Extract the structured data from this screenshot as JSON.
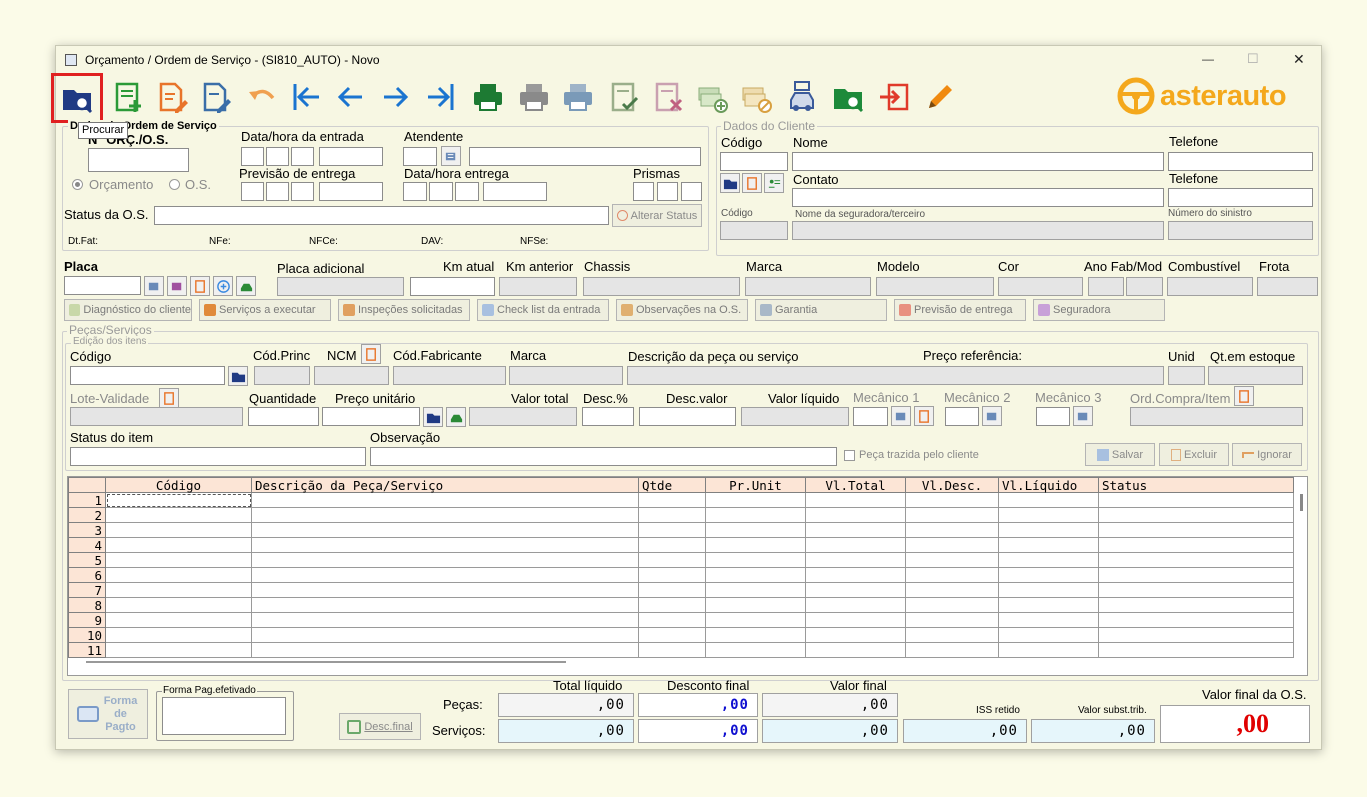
{
  "window": {
    "title": "Orçamento / Ordem de Serviço - (SI810_AUTO) - Novo",
    "minimize": "—",
    "maximize": "☐",
    "close": "✕"
  },
  "toolbar": {
    "tooltip": "Procurar"
  },
  "brand": {
    "name": "asterauto",
    "accent": "#f4a81c"
  },
  "header": {
    "group_title": "Dados da Ordem de Serviço",
    "num_label": "N° ORÇ./O.S.",
    "entrada_label": "Data/hora da entrada",
    "atendente_label": "Atendente",
    "previsao_label": "Previsão de entrega",
    "entrega_label": "Data/hora entrega",
    "prismas_label": "Prismas",
    "radio_orcamento": "Orçamento",
    "radio_os": "O.S.",
    "status_label": "Status da O.S.",
    "alterar_status": "Alterar Status",
    "dtfat": "Dt.Fat:",
    "nfe": "NFe:",
    "nfce": "NFCe:",
    "dav": "DAV:",
    "nfse": "NFSe:"
  },
  "cliente": {
    "group_title": "Dados do Cliente",
    "codigo": "Código",
    "nome": "Nome",
    "telefone1": "Telefone",
    "contato": "Contato",
    "telefone2": "Telefone",
    "codigo2": "Código",
    "seguradora": "Nome da seguradora/terceiro",
    "sinistro": "Número do sinistro"
  },
  "veiculo": {
    "placa": "Placa",
    "placa_adicional": "Placa adicional",
    "km_atual": "Km atual",
    "km_anterior": "Km anterior",
    "chassis": "Chassis",
    "marca": "Marca",
    "modelo": "Modelo",
    "cor": "Cor",
    "ano": "Ano Fab/Mod",
    "combustivel": "Combustível",
    "frota": "Frota"
  },
  "tabs": [
    "Diagnóstico do cliente",
    "Serviços a executar",
    "Inspeções solicitadas",
    "Check list da entrada",
    "Observações na O.S.",
    "Garantia",
    "Previsão de entrega",
    "Seguradora"
  ],
  "pecas": {
    "group_title": "Peças/Serviços",
    "edit_title": "Edição dos itens",
    "codigo": "Código",
    "cod_princ": "Cód.Princ",
    "ncm": "NCM",
    "cod_fab": "Cód.Fabricante",
    "marca": "Marca",
    "descricao": "Descrição da peça ou serviço",
    "preco_ref": "Preço referência:",
    "unid": "Unid",
    "qt_estoque": "Qt.em estoque",
    "lote": "Lote-Validade",
    "quantidade": "Quantidade",
    "preco_unit": "Preço unitário",
    "valor_total": "Valor total",
    "desc_pct": "Desc.%",
    "desc_valor": "Desc.valor",
    "valor_liquido": "Valor líquido",
    "mec1": "Mecânico 1",
    "mec2": "Mecânico 2",
    "mec3": "Mecânico 3",
    "ord_compra": "Ord.Compra/Item",
    "status_item": "Status do item",
    "observacao": "Observação",
    "peca_trazida": "Peça trazida pelo cliente",
    "salvar": "Salvar",
    "excluir": "Excluir",
    "ignorar": "Ignorar"
  },
  "grid": {
    "columns": [
      "Código",
      "Descrição da Peça/Serviço",
      "Qtde",
      "Pr.Unit",
      "Vl.Total",
      "Vl.Desc.",
      "Vl.Líquido",
      "Status"
    ],
    "rows": [
      "1",
      "2",
      "3",
      "4",
      "5",
      "6",
      "7",
      "8",
      "9",
      "10",
      "11"
    ]
  },
  "footer": {
    "forma_pagto": "Forma de Pagto",
    "forma_pag_efetivado": "Forma Pag.efetivado",
    "desc_final": "Desc.final",
    "pecas": "Peças:",
    "servicos": "Serviços:",
    "total_liquido": "Total líquido",
    "desconto_final": "Desconto final",
    "valor_final": "Valor final",
    "iss_retido": "ISS retido",
    "valor_subst": "Valor subst.trib.",
    "valor_final_os": "Valor final da O.S.",
    "zero": ",00",
    "final_value": ",00"
  }
}
